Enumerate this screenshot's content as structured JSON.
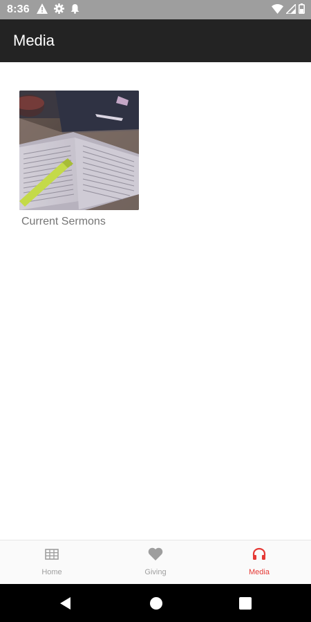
{
  "status_bar": {
    "time": "8:36",
    "left_icons": [
      "warning-icon",
      "gear-icon",
      "bell-icon"
    ],
    "right_icons": [
      "wifi-icon",
      "signal-icon",
      "battery-icon"
    ]
  },
  "app_bar": {
    "title": "Media"
  },
  "media_items": [
    {
      "label": "Current Sermons",
      "thumbnail": "open-bible-with-highlighter"
    }
  ],
  "bottom_nav": {
    "items": [
      {
        "label": "Home",
        "icon": "table-grid-icon",
        "active": false
      },
      {
        "label": "Giving",
        "icon": "heart-icon",
        "active": false
      },
      {
        "label": "Media",
        "icon": "headphones-icon",
        "active": true
      }
    ],
    "active_color": "#e53935",
    "inactive_color": "#9e9e9e"
  },
  "system_nav": {
    "buttons": [
      "back-icon",
      "home-icon",
      "recents-icon"
    ]
  }
}
